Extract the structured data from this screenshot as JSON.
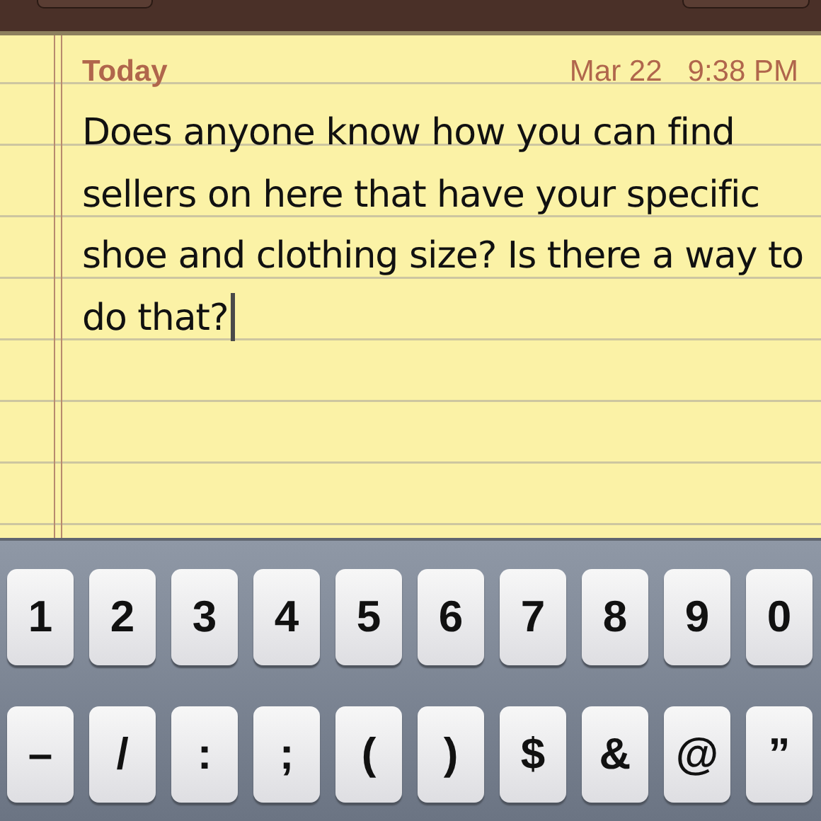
{
  "note": {
    "day": "Today",
    "date": "Mar 22",
    "time": "9:38 PM",
    "text": "Does anyone know how you can find sellers on here that have your specific shoe and clothing size? Is there a way to do that?"
  },
  "keyboard": {
    "rows": [
      [
        "1",
        "2",
        "3",
        "4",
        "5",
        "6",
        "7",
        "8",
        "9",
        "0"
      ],
      [
        "–",
        "/",
        ":",
        ";",
        "(",
        ")",
        "$",
        "&",
        "@",
        "”"
      ]
    ]
  }
}
